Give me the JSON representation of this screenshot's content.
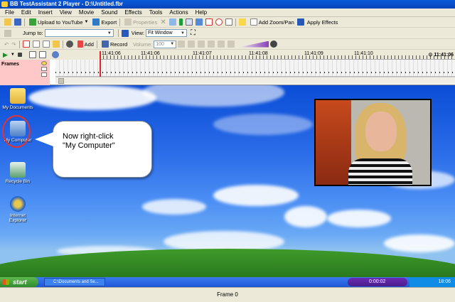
{
  "window": {
    "title": "BB TestAssistant 2 Player - D:\\Untitled.fbr"
  },
  "menu": [
    "File",
    "Edit",
    "Insert",
    "View",
    "Movie",
    "Sound",
    "Effects",
    "Tools",
    "Actions",
    "Help"
  ],
  "toolbar1": {
    "upload_label": "Upload to YouTube",
    "export_label": "Export",
    "properties_label": "Properties",
    "add_zoom_pan_label": "Add Zoom/Pan",
    "apply_effects_label": "Apply Effects"
  },
  "toolbar2": {
    "jump_to_label": "Jump to:",
    "jump_to_value": "",
    "view_label": "View:",
    "view_value": "Fit Window"
  },
  "toolbar3": {
    "add_label": "Add",
    "record_label": "Record",
    "volume_label": "Volume:",
    "volume_value": "100"
  },
  "timeline": {
    "ticks": [
      "11:41:06",
      "11:41:07",
      "11:41:08",
      "11:41:09",
      "11:41:10"
    ],
    "end_time": "11:41:06",
    "frames_label": "Frames"
  },
  "desktop": {
    "icons": [
      {
        "label": "My Documents",
        "icon": "folder-icon"
      },
      {
        "label": "My Computer",
        "icon": "computer-icon"
      },
      {
        "label": "Recycle Bin",
        "icon": "recycle-bin-icon"
      },
      {
        "label": "Internet Explorer",
        "icon": "internet-explorer-icon"
      }
    ],
    "callout_line1": "Now right-click",
    "callout_line2": "\"My Computer\""
  },
  "taskbar": {
    "start_label": "start",
    "task_item": "C:\\Documents and Se...",
    "media_time": "0:00:02",
    "clock": "18:06"
  },
  "statusbar": {
    "frame": "Frame 0"
  },
  "colors": {
    "title_bar": "#0a5ad8",
    "frames_panel": "#ffc8c8",
    "playhead": "#d8262a",
    "callout_ring": "#e03434"
  }
}
